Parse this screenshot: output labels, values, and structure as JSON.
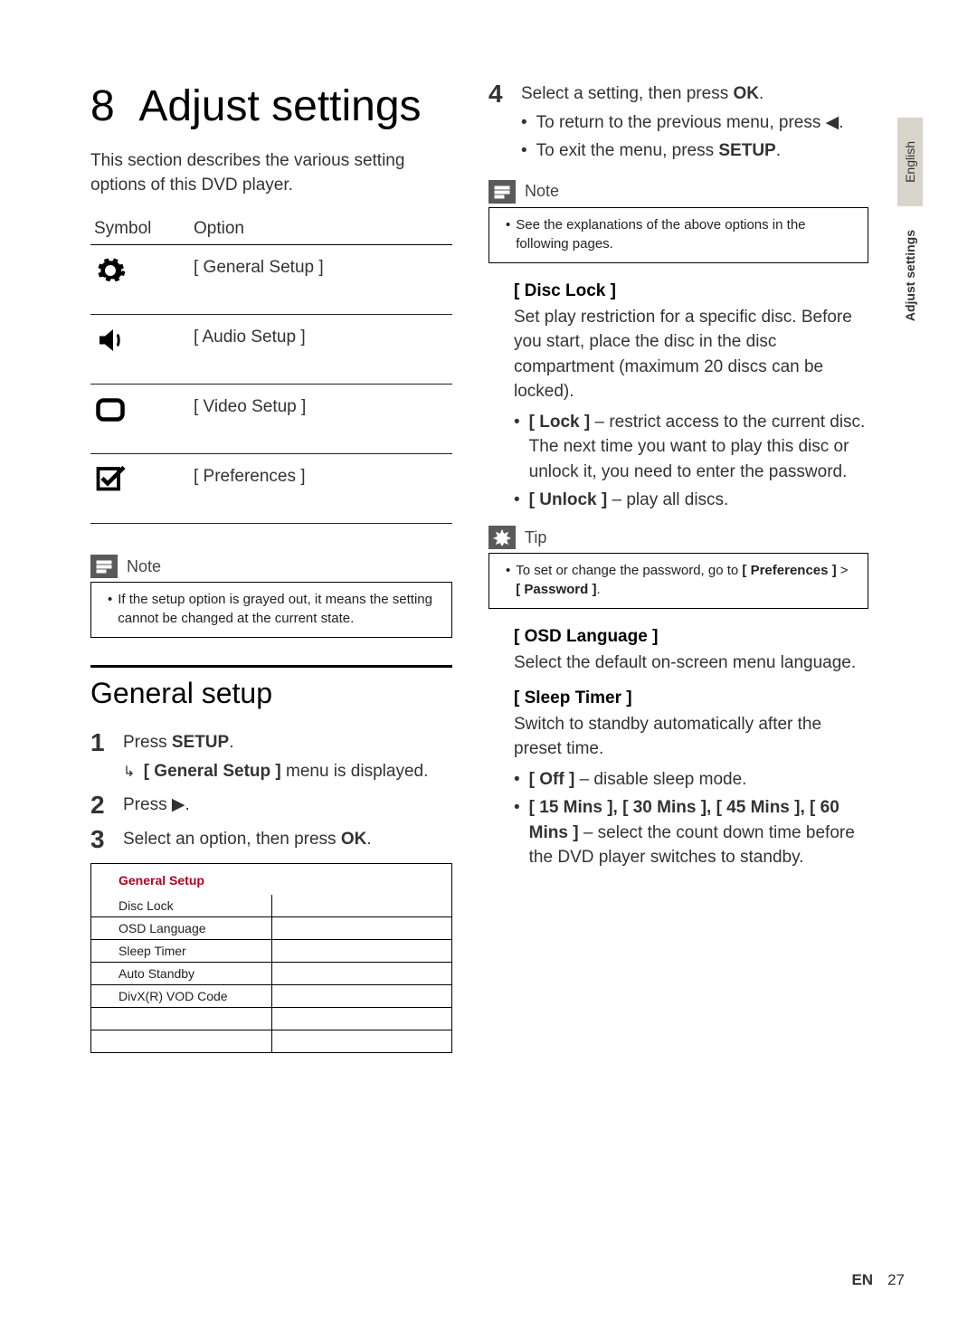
{
  "chapter_num": "8",
  "chapter_title": "Adjust settings",
  "intro": "This section describes the various setting options of this DVD player.",
  "symtab": {
    "head_symbol": "Symbol",
    "head_option": "Option",
    "rows": [
      {
        "option": "[ General Setup ]"
      },
      {
        "option": "[ Audio Setup ]"
      },
      {
        "option": "[ Video Setup ]"
      },
      {
        "option": "[ Preferences ]"
      }
    ]
  },
  "note1": {
    "label": "Note",
    "text": "If the setup option is grayed out, it means the setting cannot be changed at the current state."
  },
  "h2": "General setup",
  "steps": {
    "s1_a": "Press ",
    "s1_b": "SETUP",
    "s1_sub_a": "[ General Setup ]",
    "s1_sub_b": " menu is displayed.",
    "s2_a": "Press ",
    "s3_a": "Select an option, then press ",
    "s3_b": "OK",
    "s4_a": "Select a setting, then press ",
    "s4_b": "OK",
    "s4_sub1": "To return to the previous menu, press ",
    "s4_sub2_a": "To exit the menu, press ",
    "s4_sub2_b": "SETUP"
  },
  "menushot": {
    "title": "General Setup",
    "items": [
      "Disc Lock",
      "OSD Language",
      "Sleep Timer",
      "Auto Standby",
      "DivX(R) VOD Code"
    ]
  },
  "note2": {
    "label": "Note",
    "text": "See the explanations of the above options in the following pages."
  },
  "disclock": {
    "title": "[ Disc Lock ]",
    "desc": "Set play restriction for a specific disc. Before you start, place the disc in the disc compartment (maximum 20 discs can be locked).",
    "b1_a": "[ Lock ]",
    "b1_b": " – restrict access to the current disc. The next time you want to play this disc or unlock it, you need to enter the password.",
    "b2_a": "[ Unlock ]",
    "b2_b": " – play all discs."
  },
  "tip": {
    "label": "Tip",
    "text_a": "To set or change the password, go to ",
    "text_b": "[ Preferences ]",
    "text_c": " > ",
    "text_d": "[ Password ]",
    "text_e": "."
  },
  "osd": {
    "title": "[ OSD Language ]",
    "desc": "Select the default on-screen menu language."
  },
  "sleep": {
    "title": "[ Sleep Timer ]",
    "desc": "Switch to standby automatically after the preset time.",
    "b1_a": "[ Off ]",
    "b1_b": " – disable sleep mode.",
    "b2_a": "[ 15 Mins ], [ 30 Mins ], [ 45 Mins ], [ 60 Mins ]",
    "b2_b": " – select the count down time before the DVD player switches to standby."
  },
  "sidetab": {
    "lang": "English",
    "sec": "Adjust settings"
  },
  "footer": {
    "lang": "EN",
    "page": "27"
  }
}
